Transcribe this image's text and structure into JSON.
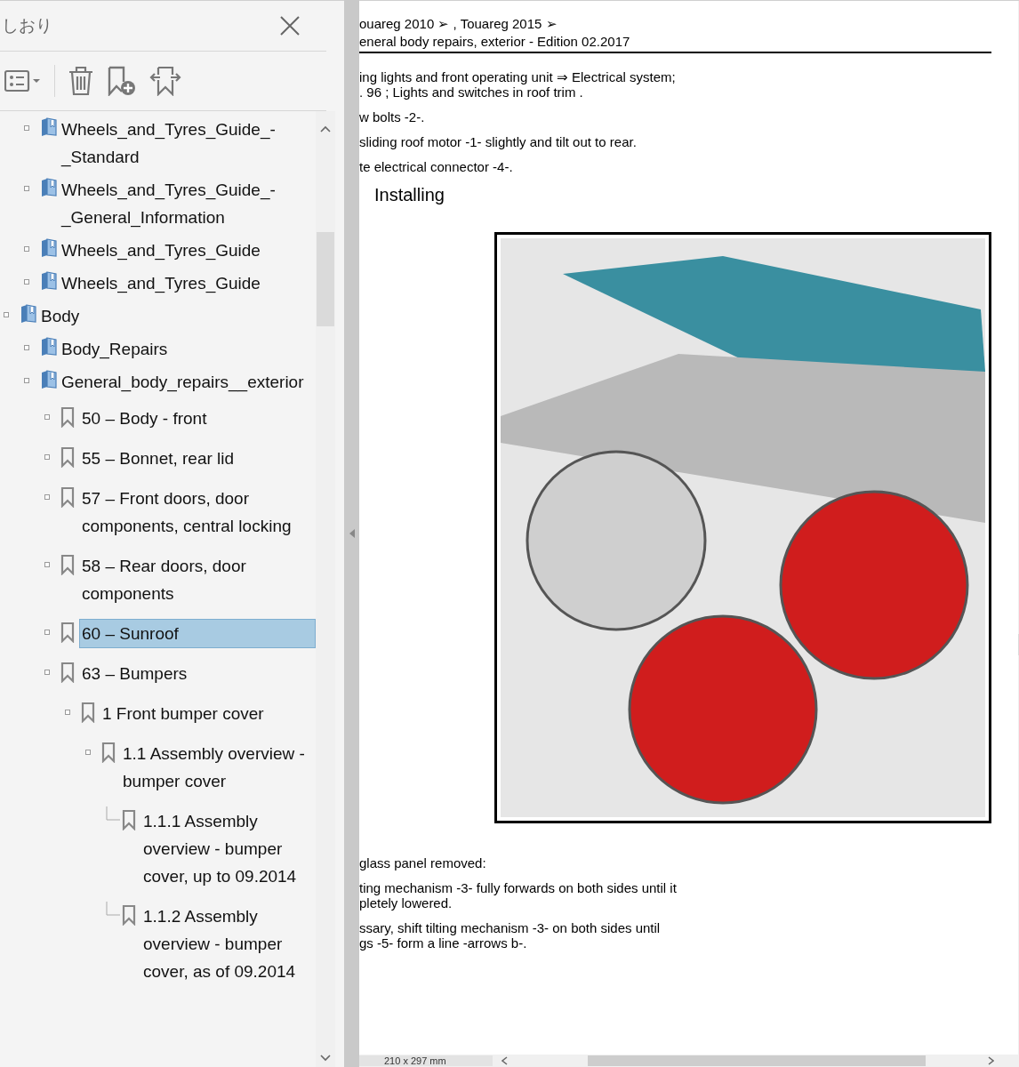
{
  "bookmarks_panel": {
    "title": "しおり",
    "tree": [
      {
        "children": [
          {
            "label": "Wheels_and_Tyres_Guide_-_Standard",
            "kind": "book",
            "expander": true,
            "selected": false
          },
          {
            "label": "Wheels_and_Tyres_Guide_-_General_Information",
            "kind": "book",
            "expander": true,
            "selected": false
          },
          {
            "label": "Wheels_and_Tyres_Guide",
            "kind": "book",
            "expander": true,
            "selected": false
          },
          {
            "label": "Wheels_and_Tyres_Guide",
            "kind": "book",
            "expander": true,
            "selected": false
          }
        ]
      },
      {
        "label": "Body",
        "kind": "book",
        "expander": true,
        "selected": false,
        "children": [
          {
            "label": "Body_Repairs",
            "kind": "book",
            "expander": true,
            "selected": false
          },
          {
            "label": "General_body_repairs__exterior",
            "kind": "book",
            "expander": true,
            "selected": false,
            "children": [
              {
                "label": "50 – Body - front",
                "kind": "plain",
                "expander": true,
                "selected": false
              },
              {
                "label": "55 – Bonnet, rear lid",
                "kind": "plain",
                "expander": true,
                "selected": false
              },
              {
                "label": "57 – Front doors, door components, central locking",
                "kind": "plain",
                "expander": true,
                "selected": false
              },
              {
                "label": "58 – Rear doors, door components",
                "kind": "plain",
                "expander": true,
                "selected": false
              },
              {
                "label": "60 – Sunroof",
                "kind": "plain",
                "expander": true,
                "selected": true
              },
              {
                "label": "63 – Bumpers",
                "kind": "plain",
                "expander": true,
                "selected": false,
                "children": [
                  {
                    "label": "1 Front bumper cover",
                    "kind": "plain",
                    "expander": true,
                    "selected": false,
                    "children": [
                      {
                        "label": "1.1 Assembly overview - bumper cover",
                        "kind": "plain",
                        "expander": true,
                        "selected": false,
                        "children": [
                          {
                            "label": "1.1.1 Assembly overview - bumper cover, up to 09.2014",
                            "kind": "plain",
                            "expander": false,
                            "selected": false
                          },
                          {
                            "label": "1.1.2 Assembly overview - bumper cover, as of 09.2014",
                            "kind": "plain",
                            "expander": false,
                            "selected": false
                          }
                        ]
                      }
                    ]
                  }
                ]
              }
            ]
          }
        ]
      }
    ]
  },
  "document": {
    "header": [
      "ouareg 2010 ➢ , Touareg 2015 ➢",
      "eneral body repairs, exterior - Edition 02.2017"
    ],
    "paragraphs_before": [
      {
        "lines": [
          "ing lights and front operating unit ⇒  Electrical system;",
          ".  96 ; Lights and switches in roof trim ."
        ]
      },
      {
        "lines": [
          "w bolts -2-."
        ]
      },
      {
        "lines": [
          "sliding roof motor -1- slightly and tilt out to rear."
        ]
      },
      {
        "lines": [
          "te electrical connector -4-."
        ]
      }
    ],
    "heading": "Installing",
    "paragraphs_after": [
      {
        "lines": [
          "glass panel removed:"
        ]
      },
      {
        "lines": [
          "ting mechanism -3- fully forwards on both sides until it",
          "pletely lowered."
        ]
      },
      {
        "lines": [
          "ssary, shift tilting mechanism -3- on both sides until",
          "gs -5- form a line -arrows b-."
        ]
      }
    ],
    "page_size": "210 x 297 mm"
  }
}
